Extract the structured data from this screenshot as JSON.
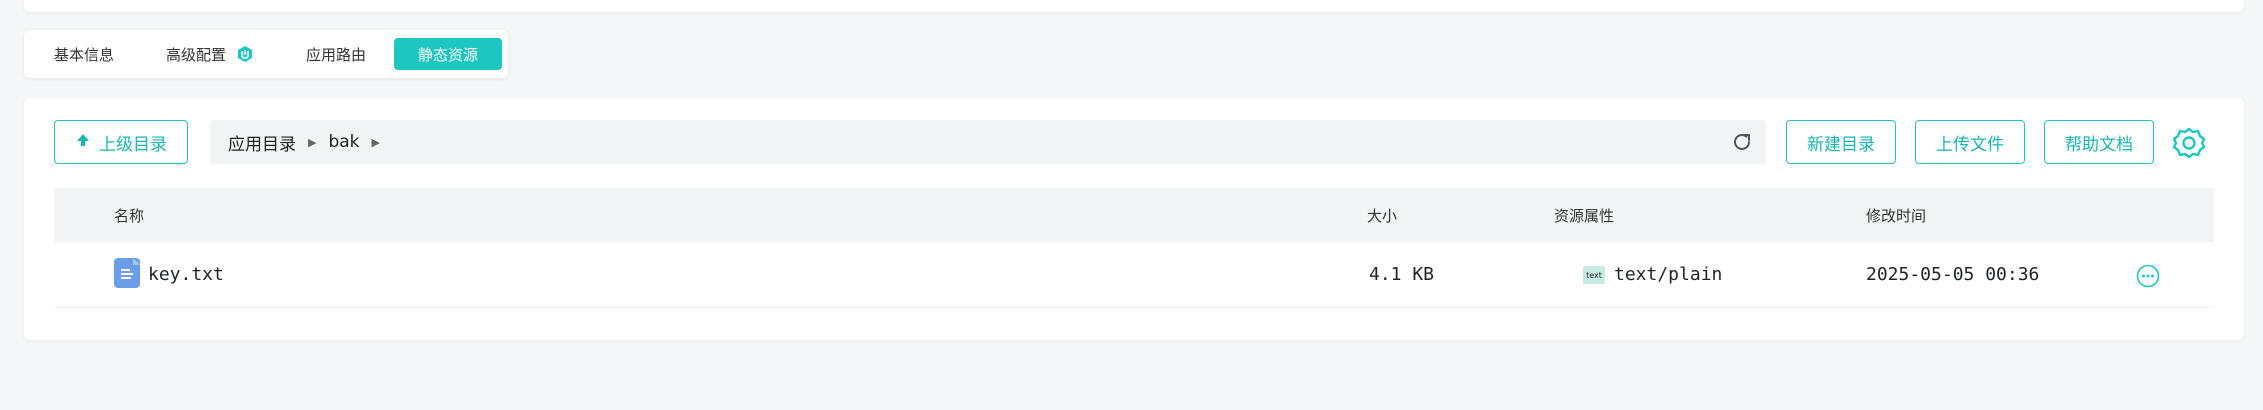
{
  "tabs": [
    {
      "label": "基本信息",
      "active": false
    },
    {
      "label": "高级配置",
      "active": false,
      "icon": "badge-icon"
    },
    {
      "label": "应用路由",
      "active": false
    },
    {
      "label": "静态资源",
      "active": true
    }
  ],
  "toolbar": {
    "parent_dir_label": "上级目录",
    "new_dir_label": "新建目录",
    "upload_label": "上传文件",
    "help_label": "帮助文档"
  },
  "breadcrumb": [
    "应用目录",
    "bak"
  ],
  "table": {
    "headers": {
      "name": "名称",
      "size": "大小",
      "attr": "资源属性",
      "mtime": "修改时间"
    },
    "rows": [
      {
        "name": "key.txt",
        "size": "4.1 KB",
        "attr": "text/plain",
        "mtime": "2025-05-05 00:36"
      }
    ]
  },
  "colors": {
    "accent": "#1ec6c0",
    "file_icon": "#6b9ee8"
  }
}
